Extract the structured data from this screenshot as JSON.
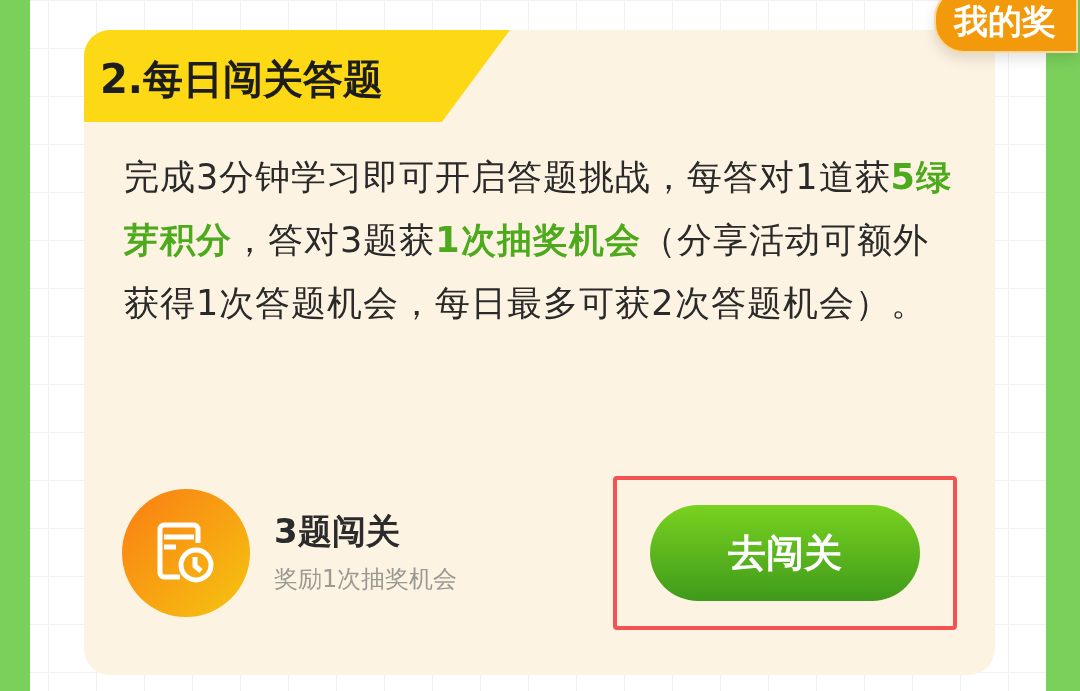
{
  "prize_badge": {
    "label": "我的奖"
  },
  "section": {
    "title": "2.每日闯关答题",
    "description": "完成3分钟学习即可开启答题挑战，每答对1道获**5绿芽积分**，答对3题获**1次抽奖机会**（分享活动可额外获得1次答题机会，每日最多可获2次答题机会）。",
    "task": {
      "title": "3题闯关",
      "subtitle": "奖励1次抽奖机会",
      "button": "去闯关",
      "highlighted": true
    }
  }
}
